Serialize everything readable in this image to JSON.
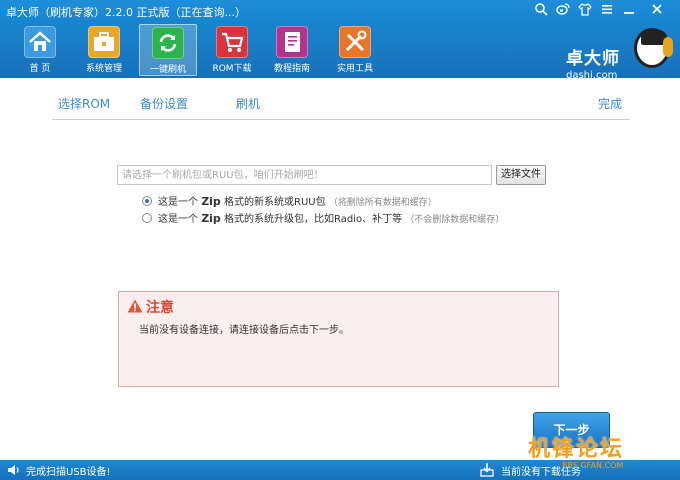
{
  "window": {
    "title": "卓大师（刷机专家）2.2.0 正式版（正在查询...）",
    "controls": [
      "ring-icon",
      "weibo-icon",
      "shirt-icon",
      "menu-icon",
      "minimize-icon",
      "close-icon"
    ]
  },
  "nav": {
    "items": [
      {
        "label": "首 页",
        "icon": "home-icon",
        "color": "#3a9be0"
      },
      {
        "label": "系统管理",
        "icon": "toolbox-icon",
        "color": "#e8a825"
      },
      {
        "label": "一键刷机",
        "icon": "refresh-icon",
        "color": "#2db34a",
        "active": true
      },
      {
        "label": "ROM下载",
        "icon": "cart-icon",
        "color": "#d9343c"
      },
      {
        "label": "教程指南",
        "icon": "book-icon",
        "color": "#b4338d"
      },
      {
        "label": "实用工具",
        "icon": "tools-icon",
        "color": "#e8762a"
      }
    ]
  },
  "brand": {
    "name_cn": "卓大师",
    "name_en": "dashi.com"
  },
  "steps": {
    "select_rom": "选择ROM",
    "backup": "备份设置",
    "flash": "刷机",
    "done": "完成"
  },
  "file": {
    "placeholder": "请选择一个刷机包或RUU包，咱们开始刷吧！",
    "choose_label": "选择文件"
  },
  "options": [
    {
      "prefix": "这是一个",
      "zip": "Zip",
      "text": "格式的新系统或RUU包",
      "hint": "（将删除所有数据和缓存）",
      "checked": true
    },
    {
      "prefix": "这是一个",
      "zip": "Zip",
      "text": "格式的系统升级包，比如Radio、补丁等",
      "hint": "（不会删除数据和缓存）",
      "checked": false
    }
  ],
  "notice": {
    "title": "注意",
    "message": "当前没有设备连接，请连接设备后点击下一步。"
  },
  "next_label": "下一步",
  "status": {
    "left": "完成扫描USB设备!",
    "right": "当前没有下载任务"
  },
  "watermark": {
    "logo": "机锋论坛",
    "url": "BBS.GFAN.COM"
  }
}
